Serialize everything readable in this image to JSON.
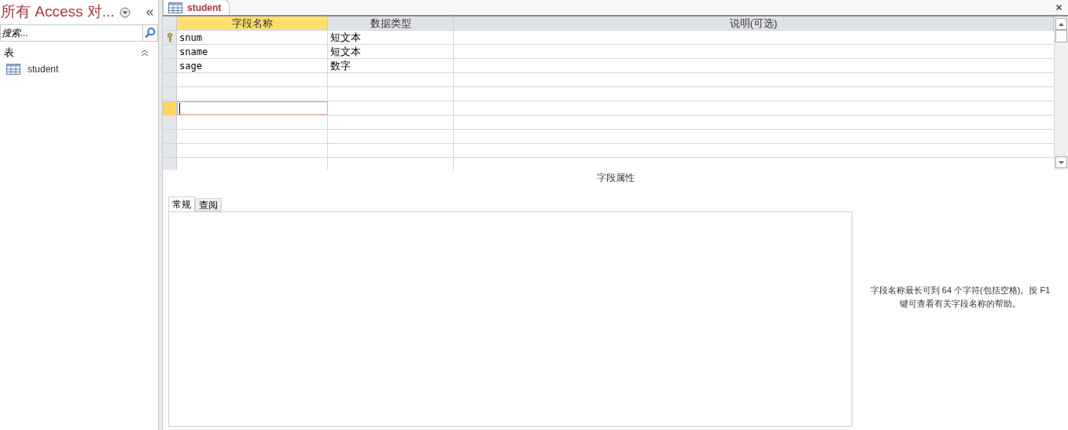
{
  "nav_pane": {
    "title": "所有 Access 对...",
    "search": {
      "placeholder": "搜索..."
    },
    "groups": [
      {
        "label": "表",
        "expanded": true,
        "items": [
          {
            "label": "student",
            "selected": false
          }
        ]
      }
    ]
  },
  "document_tabs": [
    {
      "label": "student",
      "selected": true
    }
  ],
  "table": {
    "columns": [
      "字段名称",
      "数据类型",
      "说明(可选)"
    ],
    "rows": [
      {
        "field_name": "snum",
        "data_type": "短文本",
        "primary_key": true,
        "selected": false
      },
      {
        "field_name": "sname",
        "data_type": "短文本",
        "primary_key": false,
        "selected": false
      },
      {
        "field_name": "sage",
        "data_type": "数字",
        "primary_key": false,
        "selected": false
      },
      {
        "primary_key": false,
        "selected": false
      },
      {
        "primary_key": false,
        "selected": false
      },
      {
        "primary_key": false,
        "selected": true
      },
      {
        "primary_key": false,
        "selected": false
      },
      {
        "primary_key": false,
        "selected": false
      },
      {
        "primary_key": false,
        "selected": false
      },
      {
        "primary_key": false,
        "selected": false
      }
    ]
  },
  "field_properties": {
    "title": "字段属性",
    "tabs": [
      {
        "label": "常规",
        "selected": true
      },
      {
        "label": "查阅",
        "selected": false
      }
    ],
    "help_text": "字段名称最长可到 64 个字符(包括空格)。按 F1 键可查看有关字段名称的帮助。"
  }
}
